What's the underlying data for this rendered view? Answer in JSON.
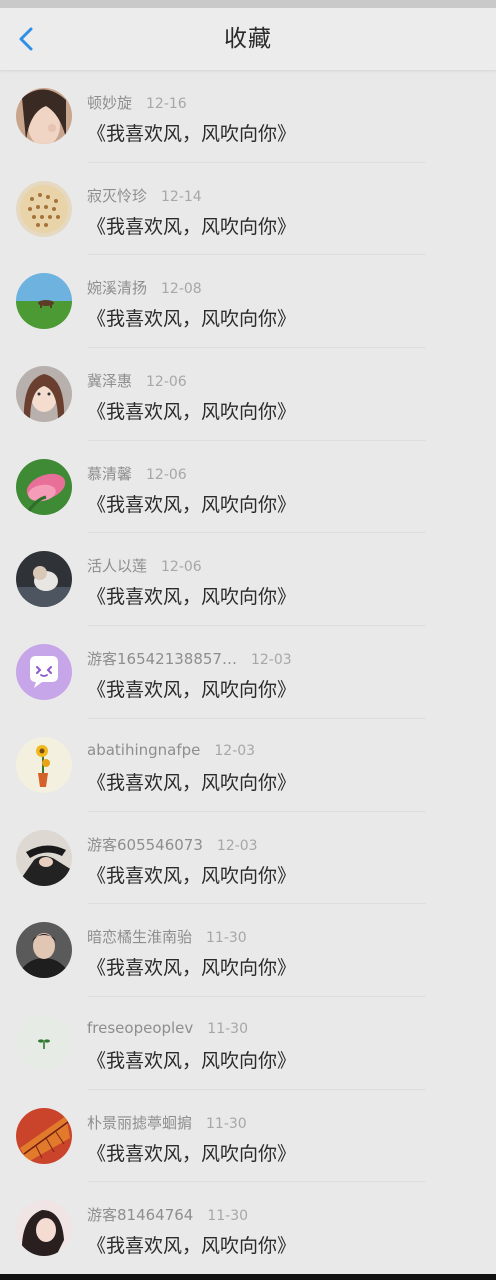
{
  "header": {
    "title": "收藏",
    "back_icon": "chevron-left-icon"
  },
  "colors": {
    "accent": "#2f8fe6",
    "background": "#e9e9e9"
  },
  "items": [
    {
      "name": "顿妙旋",
      "date": "12-16",
      "message": "《我喜欢风，风吹向你》"
    },
    {
      "name": "寂灭怜珍",
      "date": "12-14",
      "message": "《我喜欢风，风吹向你》"
    },
    {
      "name": "婉溪清扬",
      "date": "12-08",
      "message": "《我喜欢风，风吹向你》"
    },
    {
      "name": "冀泽惠",
      "date": "12-06",
      "message": "《我喜欢风，风吹向你》"
    },
    {
      "name": "慕清馨",
      "date": "12-06",
      "message": "《我喜欢风，风吹向你》"
    },
    {
      "name": "活人以莲",
      "date": "12-06",
      "message": "《我喜欢风，风吹向你》"
    },
    {
      "name": "游客16542138857…",
      "date": "12-03",
      "message": "《我喜欢风，风吹向你》"
    },
    {
      "name": "abatihingnafpe",
      "date": "12-03",
      "message": "《我喜欢风，风吹向你》"
    },
    {
      "name": "游客605546073",
      "date": "12-03",
      "message": "《我喜欢风，风吹向你》"
    },
    {
      "name": "暗恋橘生淮南骀",
      "date": "11-30",
      "message": "《我喜欢风，风吹向你》"
    },
    {
      "name": "freseopeoplev",
      "date": "11-30",
      "message": "《我喜欢风，风吹向你》"
    },
    {
      "name": "朴景丽摅葶蛔掮",
      "date": "11-30",
      "message": "《我喜欢风，风吹向你》"
    },
    {
      "name": "游客81464764",
      "date": "11-30",
      "message": "《我喜欢风，风吹向你》"
    }
  ]
}
